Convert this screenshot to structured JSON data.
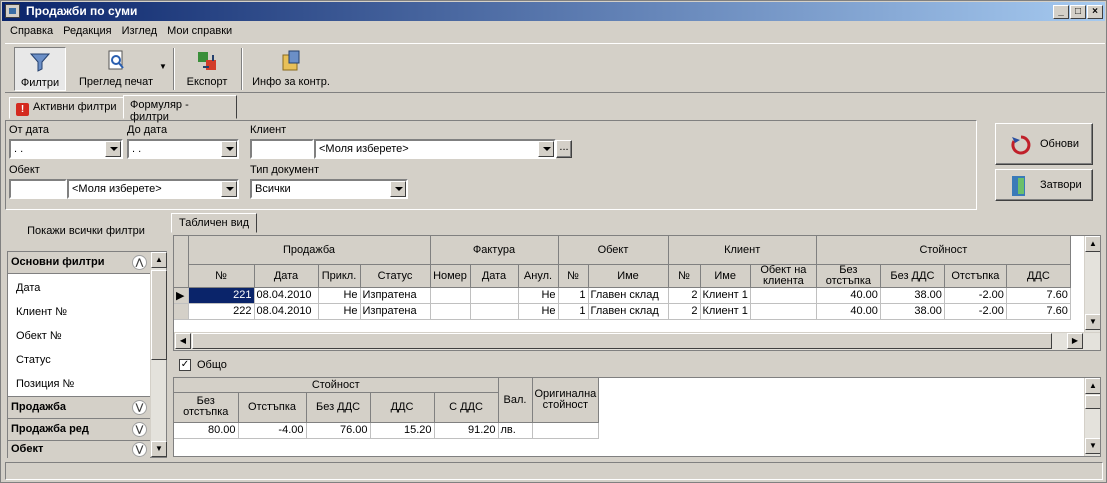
{
  "window": {
    "title": "Продажби по суми"
  },
  "menu": [
    "Справка",
    "Редакция",
    "Изглед",
    "Мои справки"
  ],
  "toolbar": {
    "filters": "Филтри",
    "print_preview": "Преглед печат",
    "export": "Експорт",
    "info": "Инфо за контр."
  },
  "tabs": {
    "active_filters": "Активни филтри",
    "form_filters": "Формуляр - филтри"
  },
  "form": {
    "from_date_label": "От дата",
    "from_date_value": " .  .",
    "to_date_label": "До дата",
    "to_date_value": " .  .",
    "client_label": "Клиент",
    "client_value": "<Моля изберете>",
    "object_label": "Обект",
    "object_value": "<Моля изберете>",
    "doctype_label": "Тип документ",
    "doctype_value": "Всички",
    "browse": "..."
  },
  "buttons": {
    "refresh": "Обнови",
    "close": "Затвори"
  },
  "left": {
    "show_all": "Покажи всички филтри",
    "groups": {
      "basic": "Основни филтри",
      "sale": "Продажба",
      "sale_row": "Продажба ред",
      "object": "Обект"
    },
    "items": [
      "Дата",
      "Клиент №",
      "Обект №",
      "Статус",
      "Позиция №"
    ]
  },
  "view_tab": "Табличен вид",
  "grid": {
    "groups": {
      "sale": "Продажба",
      "invoice": "Фактура",
      "object": "Обект",
      "client": "Клиент",
      "value": "Стойност"
    },
    "cols": [
      "№",
      "Дата",
      "Прикл.",
      "Статус",
      "Номер",
      "Дата",
      "Анул.",
      "№",
      "Име",
      "№",
      "Име",
      "Обект на клиента",
      "Без отстъпка",
      "Без ДДС",
      "Отстъпка",
      "ДДС"
    ],
    "rows": [
      [
        "221",
        "08.04.2010",
        "Не",
        "Изпратена",
        "",
        "",
        "Не",
        "1",
        "Главен склад",
        "2",
        "Клиент 1",
        "",
        "40.00",
        "38.00",
        "-2.00",
        "7.60"
      ],
      [
        "222",
        "08.04.2010",
        "Не",
        "Изпратена",
        "",
        "",
        "Не",
        "1",
        "Главен склад",
        "2",
        "Клиент 1",
        "",
        "40.00",
        "38.00",
        "-2.00",
        "7.60"
      ]
    ]
  },
  "total": {
    "checkbox_label": "Общо",
    "group_value": "Стойност",
    "cols": [
      "Без отстъпка",
      "Отстъпка",
      "Без ДДС",
      "ДДС",
      "С ДДС",
      "Вал.",
      "Оригинална стойност"
    ],
    "row": [
      "80.00",
      "-4.00",
      "76.00",
      "15.20",
      "91.20",
      "лв.",
      ""
    ]
  }
}
